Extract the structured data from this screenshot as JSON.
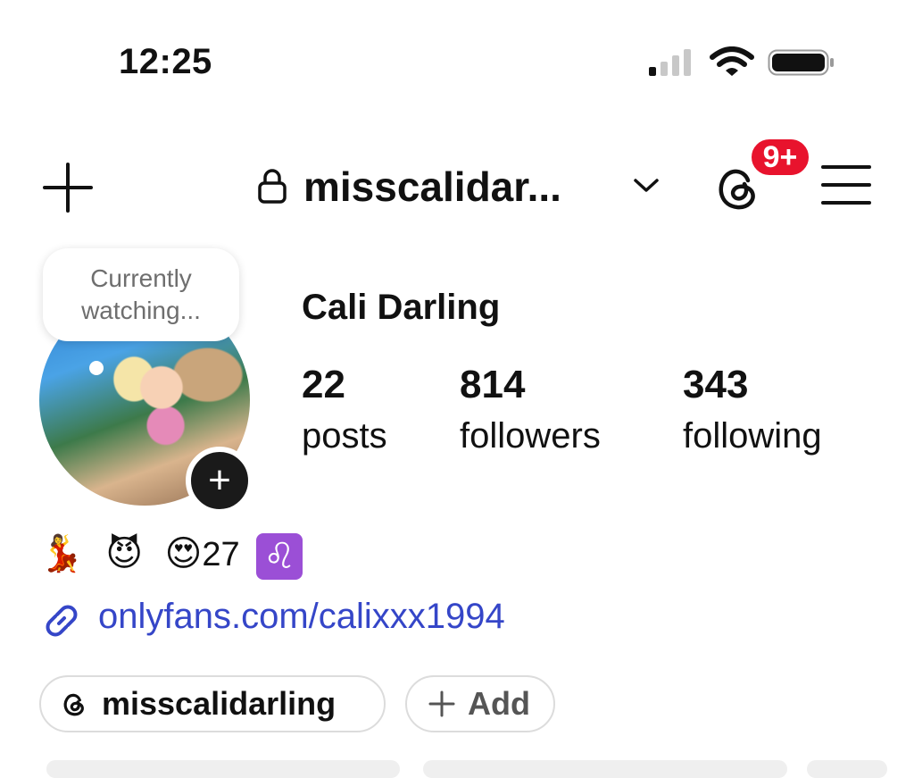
{
  "status_bar": {
    "time": "12:25",
    "signal_icon": "cellular-signal-icon",
    "wifi_icon": "wifi-icon",
    "battery_icon": "battery-icon"
  },
  "header": {
    "username": "misscalidar...",
    "notification_badge": "9+",
    "icons": [
      "plus-icon",
      "lock-icon",
      "chevron-down-icon",
      "threads-icon",
      "menu-icon"
    ]
  },
  "note": {
    "line1": "Currently",
    "line2": "watching..."
  },
  "profile": {
    "display_name": "Cali Darling",
    "add_story_label": "+",
    "stats": [
      {
        "value": "22",
        "label": "posts"
      },
      {
        "value": "814",
        "label": "followers"
      },
      {
        "value": "343",
        "label": "following"
      }
    ]
  },
  "bio": {
    "emojis": [
      "💃",
      "😈",
      "😍"
    ],
    "age": "27",
    "zodiac": "♌",
    "link": "onlyfans.com/calixxx1994"
  },
  "chips": {
    "threads_handle": "misscalidarling",
    "add_label": "Add"
  },
  "colors": {
    "badge": "#e8132d",
    "link": "#3546c8",
    "zodiac_bg": "#9b4fd6"
  }
}
